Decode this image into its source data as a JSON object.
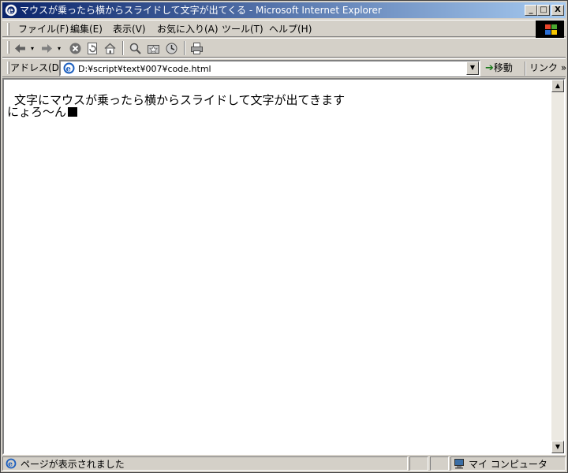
{
  "window": {
    "title": "マウスが乗ったら横からスライドして文字が出てくる - Microsoft Internet Explorer",
    "minimize_label": "_",
    "maximize_label": "□",
    "close_label": "X"
  },
  "menu": {
    "items": [
      {
        "label": "ファイル(F)"
      },
      {
        "label": "編集(E)"
      },
      {
        "label": "表示(V)"
      },
      {
        "label": "お気に入り(A)"
      },
      {
        "label": "ツール(T)"
      },
      {
        "label": "ヘルプ(H)"
      }
    ]
  },
  "address": {
    "label": "アドレス(D)",
    "value": "D:¥script¥text¥007¥code.html",
    "go_label": "移動",
    "links_label": "リンク »"
  },
  "content": {
    "line1": "文字にマウスが乗ったら横からスライドして文字が出てきます",
    "line2": "にょろ〜ん"
  },
  "status": {
    "text": "ページが表示されました",
    "zone": "マイ コンピュータ"
  },
  "colors": {
    "title_active": "#0a246a",
    "title_gradient_end": "#a6caf0",
    "chrome": "#d4d0c8"
  }
}
